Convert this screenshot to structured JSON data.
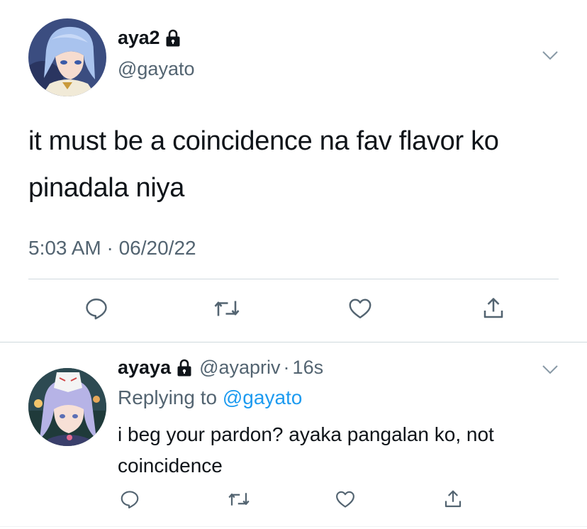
{
  "main_tweet": {
    "display_name": "aya2",
    "handle": "@gayato",
    "text": "it must be a coincidence na fav flavor ko pinadala niya",
    "timestamp": "5:03 AM · 06/20/22",
    "avatar": "anime-character-avatar",
    "protected_icon": "lock-icon"
  },
  "reply": {
    "display_name": "ayaya",
    "handle": "@ayapriv",
    "time": "16s",
    "separator": "·",
    "replying_prefix": "Replying to ",
    "replying_to": "@gayato",
    "text": "i beg your pardon? ayaka pangalan ko, not coincidence",
    "avatar": "anime-character-avatar",
    "protected_icon": "lock-icon"
  },
  "actions": [
    "reply-icon",
    "retweet-icon",
    "like-icon",
    "share-icon"
  ],
  "colors": {
    "text": "#0f1419",
    "secondary": "#536471",
    "link": "#1d9bf0",
    "divider": "#cfd9de"
  }
}
